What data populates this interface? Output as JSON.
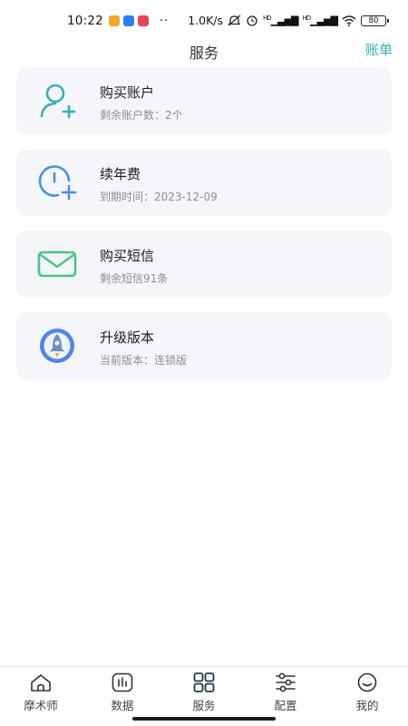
{
  "status_bar": {
    "time": "10:22",
    "network_speed": "1.0K/s",
    "signal_1": "HD",
    "signal_2": "HD",
    "battery": "80",
    "dots": "··"
  },
  "header": {
    "title": "服务",
    "bill_link": "账单"
  },
  "cards": [
    {
      "title": "购买账户",
      "subtitle": "剩余账户数：2个",
      "icon": "add-user-icon"
    },
    {
      "title": "续年费",
      "subtitle": "到期时间：2023-12-09",
      "icon": "clock-plus-icon"
    },
    {
      "title": "购买短信",
      "subtitle": "剩余短信91条",
      "icon": "envelope-icon"
    },
    {
      "title": "升级版本",
      "subtitle": "当前版本：连锁版",
      "icon": "rocket-icon"
    }
  ],
  "bottom_nav": [
    {
      "label": "摩术师",
      "icon": "home-icon"
    },
    {
      "label": "数据",
      "icon": "chart-icon"
    },
    {
      "label": "服务",
      "icon": "grid-icon"
    },
    {
      "label": "配置",
      "icon": "sliders-icon"
    },
    {
      "label": "我的",
      "icon": "smile-icon"
    }
  ],
  "colors": {
    "accent": "#33b5a8",
    "card_bg": "#f4f6f9",
    "teal_icon": "#35b0b8",
    "blue_icon": "#4a90e2",
    "green_icon": "#4cc38a",
    "rocket_ring": "#4f86e6"
  }
}
